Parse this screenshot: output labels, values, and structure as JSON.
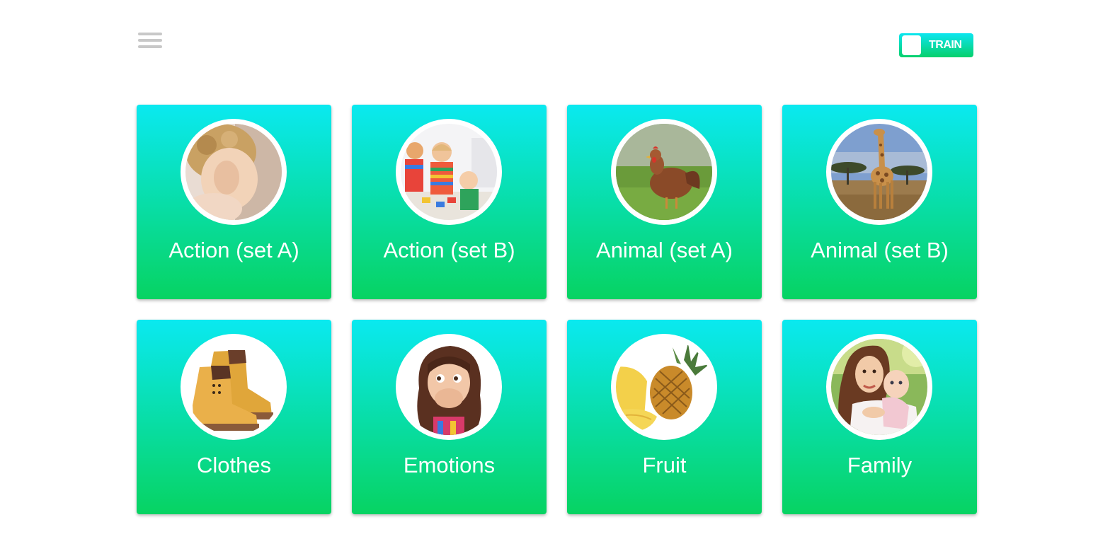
{
  "header": {
    "menu_icon": "hamburger-menu-icon",
    "train_toggle": {
      "label": "TRAIN",
      "state": "on"
    }
  },
  "categories": [
    {
      "label": "Action (set A)",
      "image": "child-rubbing-eye-photo"
    },
    {
      "label": "Action (set B)",
      "image": "children-playing-photo"
    },
    {
      "label": "Animal (set A)",
      "image": "hen-on-grass-photo"
    },
    {
      "label": "Animal (set B)",
      "image": "giraffe-savanna-photo"
    },
    {
      "label": "Clothes",
      "image": "yellow-boots-photo"
    },
    {
      "label": "Emotions",
      "image": "surprised-girl-photo"
    },
    {
      "label": "Fruit",
      "image": "pineapple-photo"
    },
    {
      "label": "Family",
      "image": "mother-and-baby-photo"
    }
  ],
  "colors": {
    "card_top": "#0ae9f0",
    "card_bottom": "#07d362",
    "menu_icon": "#c8c8c8",
    "text": "#ffffff"
  }
}
